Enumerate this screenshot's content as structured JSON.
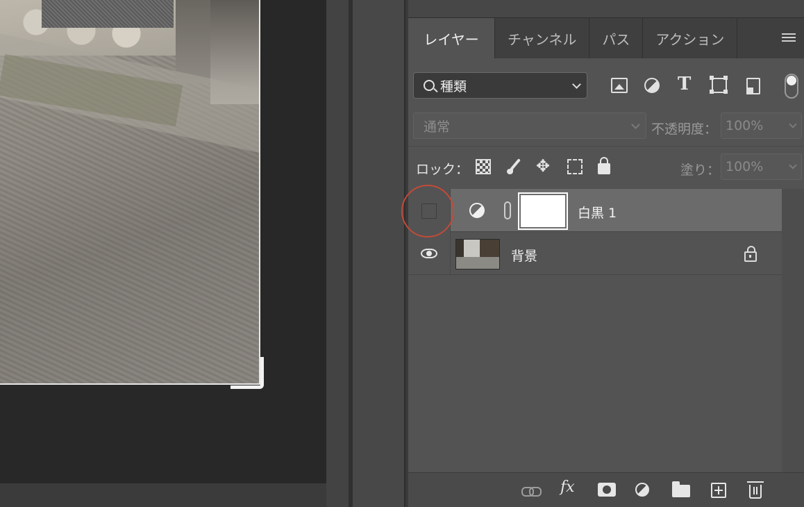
{
  "tabs": [
    {
      "label": "レイヤー",
      "active": true
    },
    {
      "label": "チャンネル",
      "active": false
    },
    {
      "label": "パス",
      "active": false
    },
    {
      "label": "アクション",
      "active": false
    }
  ],
  "filter": {
    "kind_label": "種類",
    "icons": [
      "image-filter-icon",
      "adjustment-filter-icon",
      "type-filter-icon",
      "shape-filter-icon",
      "smart-object-filter-icon"
    ]
  },
  "blend": {
    "mode": "通常",
    "opacity_label": "不透明度：",
    "opacity_value": "100%"
  },
  "lock": {
    "label": "ロック：",
    "fill_label": "塗り：",
    "fill_value": "100%"
  },
  "layers": [
    {
      "name": "白黒 1",
      "type": "adjustment",
      "visible": false,
      "selected": true
    },
    {
      "name": "背景",
      "type": "background",
      "visible": true,
      "selected": false,
      "locked": true
    }
  ],
  "colors": {
    "panel": "#535353",
    "selected_row": "#6b6b6b",
    "highlight_ring": "#c34a39"
  }
}
